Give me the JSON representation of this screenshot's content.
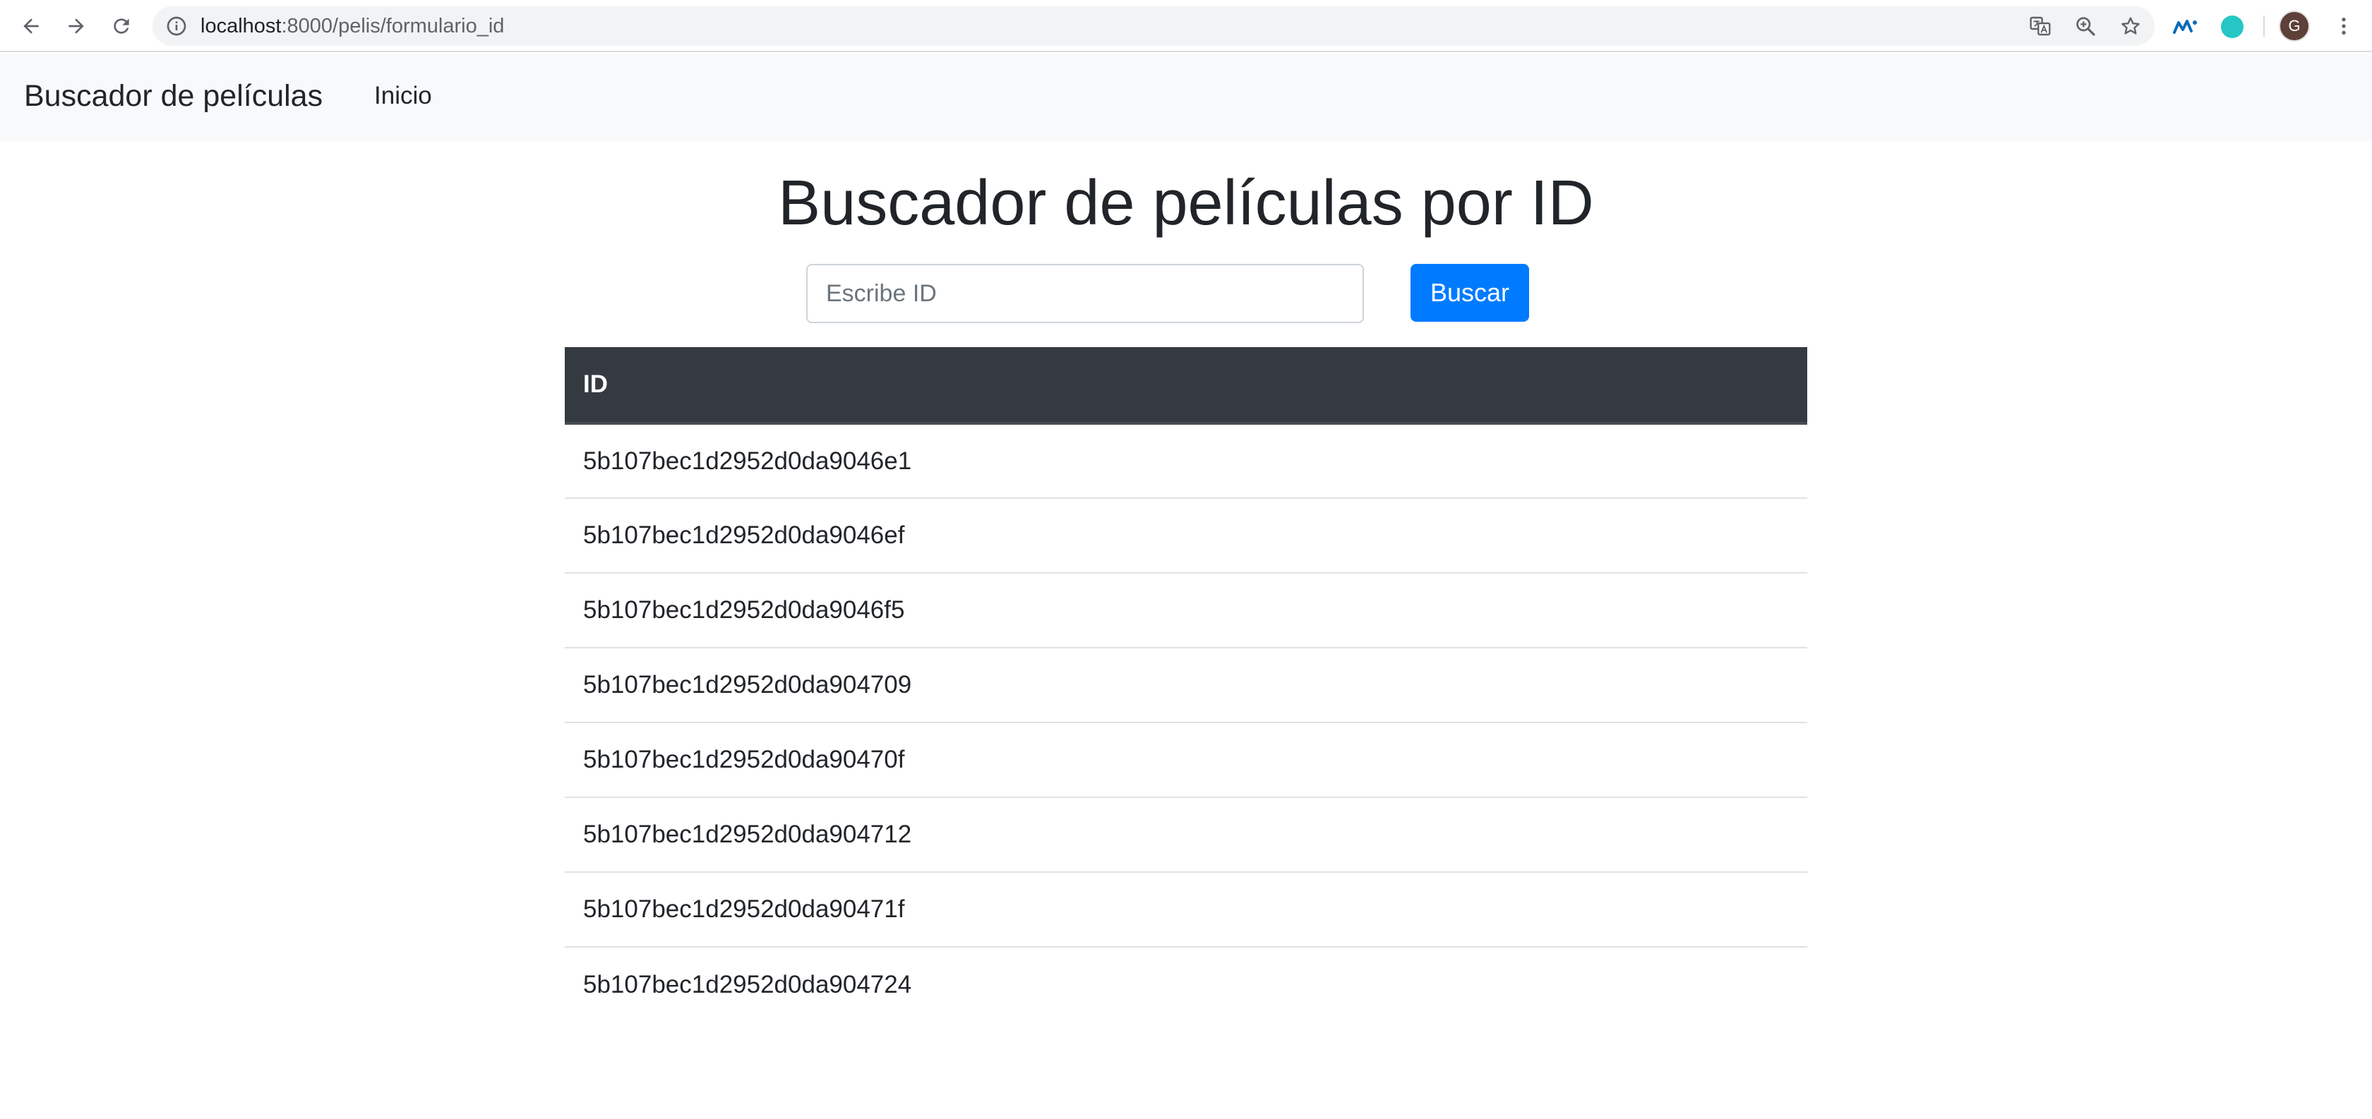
{
  "browser": {
    "url_host": "localhost",
    "url_path": ":8000/pelis/formulario_id",
    "profile_initial": "G"
  },
  "navbar": {
    "brand": "Buscador de películas",
    "links": [
      "Inicio"
    ]
  },
  "main": {
    "title": "Buscador de películas por ID",
    "search": {
      "placeholder": "Escribe ID",
      "value": "",
      "button_label": "Buscar"
    },
    "table": {
      "columns": [
        "ID"
      ],
      "rows": [
        "5b107bec1d2952d0da9046e1",
        "5b107bec1d2952d0da9046ef",
        "5b107bec1d2952d0da9046f5",
        "5b107bec1d2952d0da904709",
        "5b107bec1d2952d0da90470f",
        "5b107bec1d2952d0da904712",
        "5b107bec1d2952d0da90471f",
        "5b107bec1d2952d0da904724"
      ]
    }
  },
  "colors": {
    "primary": "#007bff",
    "table_header": "#343a40",
    "navbar_bg": "#f8f9fa",
    "text": "#212529"
  },
  "icons": [
    "back-arrow-icon",
    "forward-arrow-icon",
    "reload-icon",
    "info-icon",
    "translate-icon",
    "zoom-icon",
    "star-icon",
    "movistar-extension-icon",
    "teal-extension-icon",
    "kebab-menu-icon"
  ]
}
